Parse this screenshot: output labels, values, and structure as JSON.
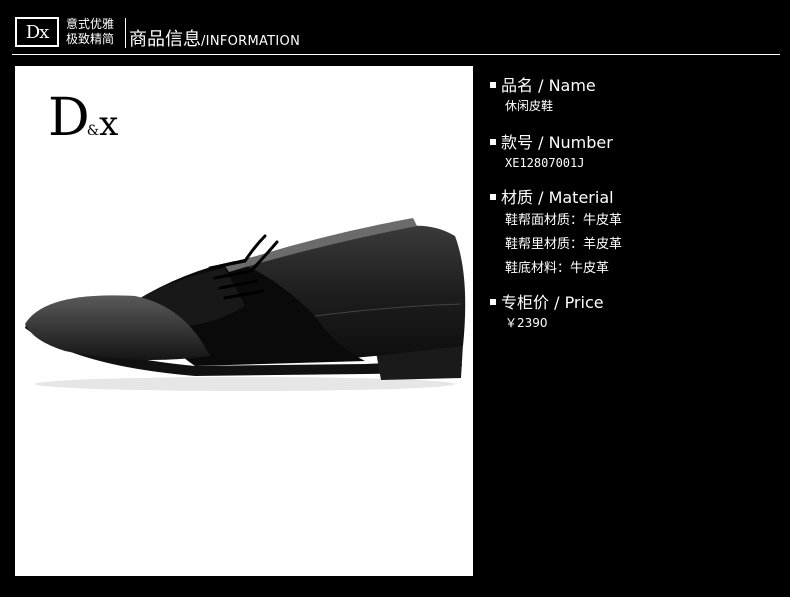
{
  "header": {
    "logo_text": "Dx",
    "slogan_line1": "意式优雅",
    "slogan_line2": "极致精简",
    "title_cn": "商品信息",
    "title_en": "/INFORMATION"
  },
  "image": {
    "brand_logo": "D&x",
    "subject": "black leather and suede oxford shoe"
  },
  "info": {
    "name": {
      "label": "品名 / Name",
      "value": "休闲皮鞋"
    },
    "number": {
      "label": "款号 / Number",
      "value": "XE12807001J"
    },
    "material": {
      "label": "材质 / Material",
      "lines": [
        "鞋帮面材质：牛皮革",
        "鞋帮里材质：羊皮革",
        "鞋底材料：牛皮革"
      ]
    },
    "price": {
      "label": "专柜价 / Price",
      "value": "￥2390"
    }
  }
}
